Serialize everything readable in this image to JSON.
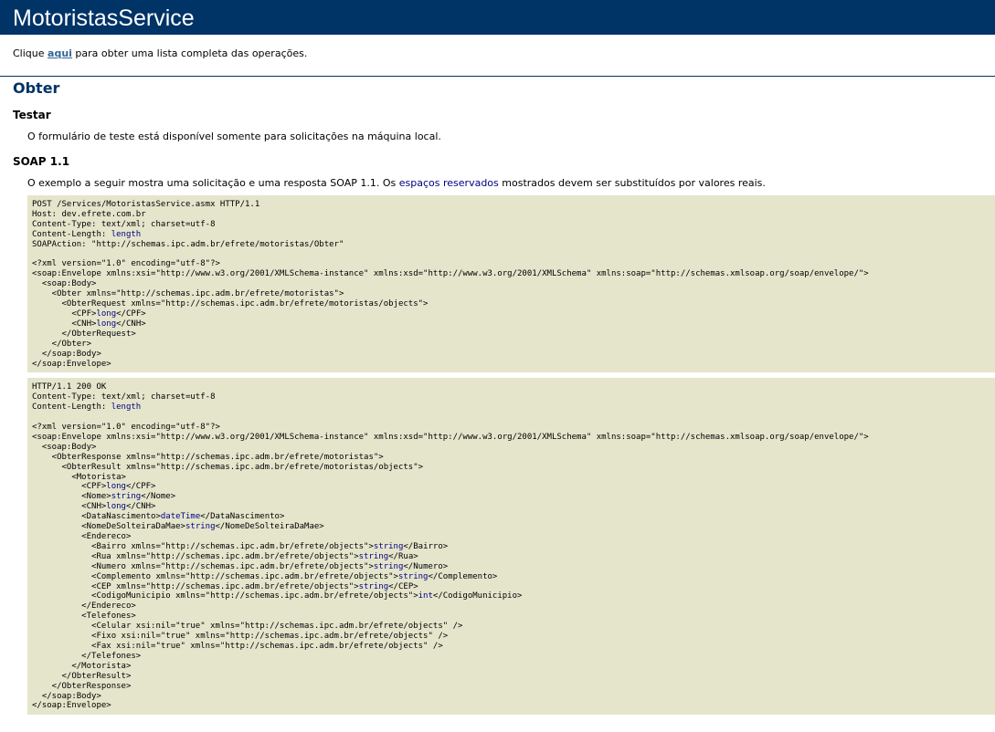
{
  "service_title": "MotoristasService",
  "intro": {
    "prefix": "Clique ",
    "link": "aqui",
    "suffix": " para obter uma lista completa das operações."
  },
  "operation": "Obter",
  "test": {
    "title": "Testar",
    "text": "O formulário de teste está disponível somente para solicitações na máquina local."
  },
  "soap11": {
    "title": "SOAP 1.1",
    "text_before": "O exemplo a seguir mostra uma solicitação e uma resposta SOAP 1.1. Os ",
    "placeholder_text": "espaços reservados",
    "text_after": " mostrados devem ser substituídos por valores reais.",
    "request": [
      "POST /Services/MotoristasService.asmx HTTP/1.1",
      "Host: dev.efrete.com.br",
      "Content-Type: text/xml; charset=utf-8",
      "Content-Length: {length}",
      "SOAPAction: \"http://schemas.ipc.adm.br/efrete/motoristas/Obter\"",
      "",
      "<?xml version=\"1.0\" encoding=\"utf-8\"?>",
      "<soap:Envelope xmlns:xsi=\"http://www.w3.org/2001/XMLSchema-instance\" xmlns:xsd=\"http://www.w3.org/2001/XMLSchema\" xmlns:soap=\"http://schemas.xmlsoap.org/soap/envelope/\">",
      "  <soap:Body>",
      "    <Obter xmlns=\"http://schemas.ipc.adm.br/efrete/motoristas\">",
      "      <ObterRequest xmlns=\"http://schemas.ipc.adm.br/efrete/motoristas/objects\">",
      "        <CPF>{long}</CPF>",
      "        <CNH>{long}</CNH>",
      "      </ObterRequest>",
      "    </Obter>",
      "  </soap:Body>",
      "</soap:Envelope>"
    ],
    "response": [
      "HTTP/1.1 200 OK",
      "Content-Type: text/xml; charset=utf-8",
      "Content-Length: {length}",
      "",
      "<?xml version=\"1.0\" encoding=\"utf-8\"?>",
      "<soap:Envelope xmlns:xsi=\"http://www.w3.org/2001/XMLSchema-instance\" xmlns:xsd=\"http://www.w3.org/2001/XMLSchema\" xmlns:soap=\"http://schemas.xmlsoap.org/soap/envelope/\">",
      "  <soap:Body>",
      "    <ObterResponse xmlns=\"http://schemas.ipc.adm.br/efrete/motoristas\">",
      "      <ObterResult xmlns=\"http://schemas.ipc.adm.br/efrete/motoristas/objects\">",
      "        <Motorista>",
      "          <CPF>{long}</CPF>",
      "          <Nome>{string}</Nome>",
      "          <CNH>{long}</CNH>",
      "          <DataNascimento>{dateTime}</DataNascimento>",
      "          <NomeDeSolteiraDaMae>{string}</NomeDeSolteiraDaMae>",
      "          <Endereco>",
      "            <Bairro xmlns=\"http://schemas.ipc.adm.br/efrete/objects\">{string}</Bairro>",
      "            <Rua xmlns=\"http://schemas.ipc.adm.br/efrete/objects\">{string}</Rua>",
      "            <Numero xmlns=\"http://schemas.ipc.adm.br/efrete/objects\">{string}</Numero>",
      "            <Complemento xmlns=\"http://schemas.ipc.adm.br/efrete/objects\">{string}</Complemento>",
      "            <CEP xmlns=\"http://schemas.ipc.adm.br/efrete/objects\">{string}</CEP>",
      "            <CodigoMunicipio xmlns=\"http://schemas.ipc.adm.br/efrete/objects\">{int}</CodigoMunicipio>",
      "          </Endereco>",
      "          <Telefones>",
      "            <Celular xsi:nil=\"true\" xmlns=\"http://schemas.ipc.adm.br/efrete/objects\" />",
      "            <Fixo xsi:nil=\"true\" xmlns=\"http://schemas.ipc.adm.br/efrete/objects\" />",
      "            <Fax xsi:nil=\"true\" xmlns=\"http://schemas.ipc.adm.br/efrete/objects\" />",
      "          </Telefones>",
      "        </Motorista>",
      "      </ObterResult>",
      "    </ObterResponse>",
      "  </soap:Body>",
      "</soap:Envelope>"
    ]
  },
  "colors": {
    "header_bg": "#003366",
    "link": "#336699",
    "placeholder": "#000080",
    "code_bg": "#e5e5cc"
  }
}
